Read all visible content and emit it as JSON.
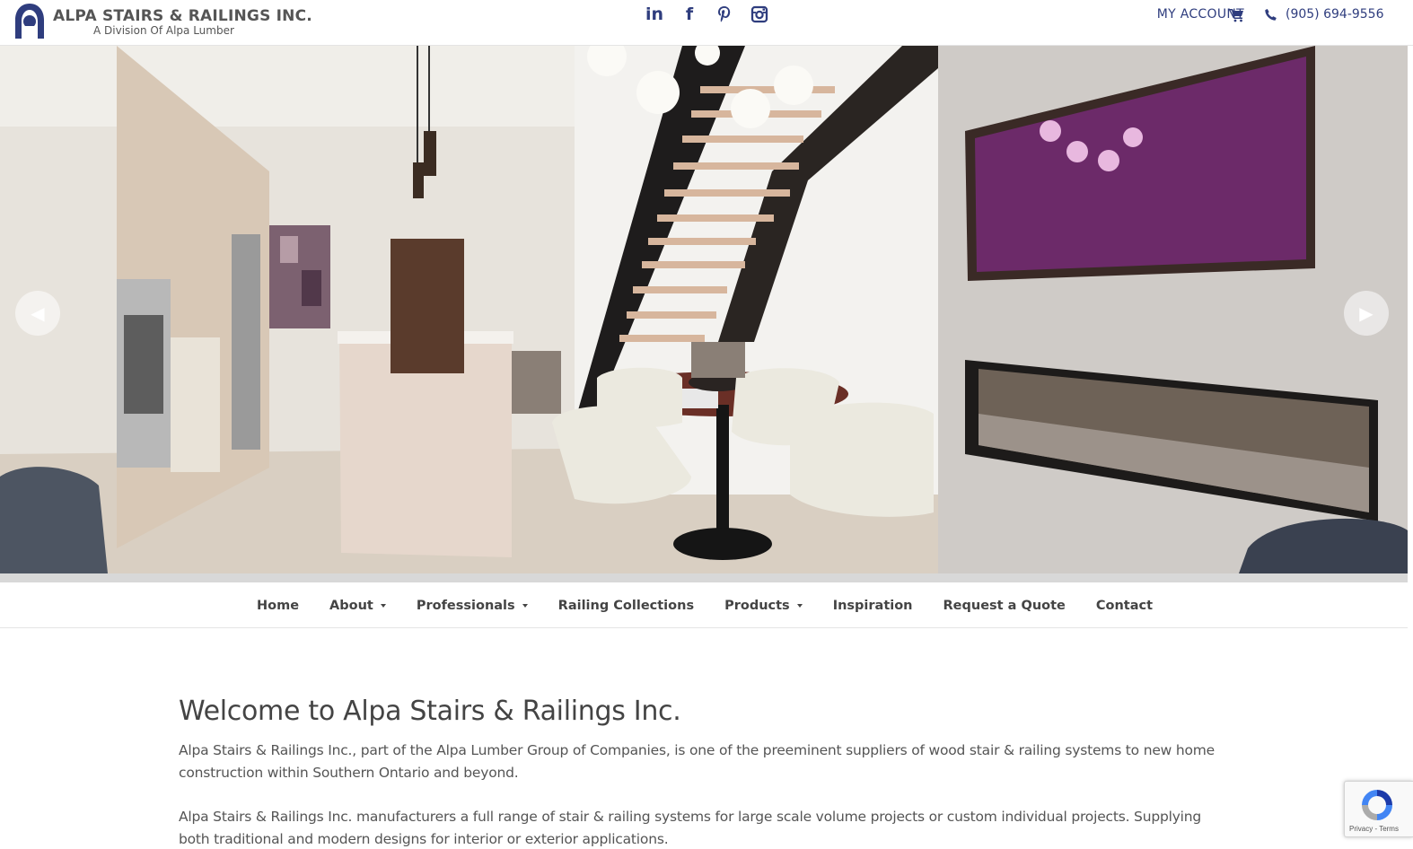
{
  "brand": {
    "name": "ALPA STAIRS & RAILINGS INC.",
    "tagline": "A Division Of Alpa Lumber",
    "color": "#2f3d7e"
  },
  "header": {
    "social": [
      {
        "icon": "linkedin-icon",
        "glyph": "in"
      },
      {
        "icon": "facebook-icon",
        "glyph": "f"
      },
      {
        "icon": "pinterest-icon",
        "glyph": "P"
      },
      {
        "icon": "instagram-icon",
        "glyph": ""
      }
    ],
    "account_label": "MY ACCOUNT",
    "phone": "(905) 694-9556"
  },
  "hero": {
    "prev_symbol": "◀",
    "next_symbol": "▶"
  },
  "nav": {
    "items": [
      {
        "label": "Home",
        "has_dropdown": false
      },
      {
        "label": "About",
        "has_dropdown": true
      },
      {
        "label": "Professionals",
        "has_dropdown": true
      },
      {
        "label": "Railing Collections",
        "has_dropdown": false
      },
      {
        "label": "Products",
        "has_dropdown": true
      },
      {
        "label": "Inspiration",
        "has_dropdown": false
      },
      {
        "label": "Request a Quote",
        "has_dropdown": false
      },
      {
        "label": "Contact",
        "has_dropdown": false
      }
    ]
  },
  "main": {
    "heading": "Welcome to Alpa Stairs & Railings Inc.",
    "paragraphs": [
      "Alpa Stairs & Railings Inc., part of the Alpa Lumber Group of Companies, is one of the preeminent suppliers of wood stair & railing systems to new home construction within Southern Ontario and beyond.",
      "Alpa Stairs & Railings Inc. manufacturers a full range of stair & railing systems for large scale volume projects or custom individual projects.  Supplying both traditional and modern designs for interior or exterior applications."
    ]
  },
  "recaptcha": {
    "terms": "Privacy - Terms"
  }
}
